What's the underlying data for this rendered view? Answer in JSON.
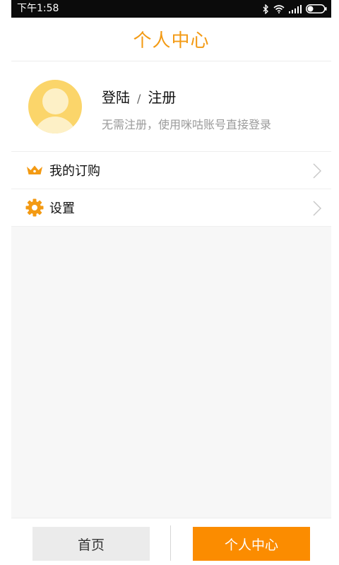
{
  "status_bar": {
    "time": "下午1:58",
    "icons": [
      "bluetooth-icon",
      "wifi-icon",
      "signal-icon",
      "battery-icon"
    ]
  },
  "header": {
    "title": "个人中心"
  },
  "profile": {
    "login_label": "登陆",
    "separator": "/",
    "register_label": "注册",
    "subtitle": "无需注册，使用咪咕账号直接登录"
  },
  "menu": {
    "items": [
      {
        "label": "我的订购",
        "icon": "crown-icon"
      },
      {
        "label": "设置",
        "icon": "gear-icon"
      }
    ]
  },
  "bottom_nav": {
    "tabs": [
      {
        "label": "首页",
        "active": false
      },
      {
        "label": "个人中心",
        "active": true
      }
    ]
  },
  "colors": {
    "accent": "#f39a13",
    "active_tab": "#fb8c00",
    "inactive_tab": "#ebebeb",
    "avatar": "#fbd56a"
  }
}
